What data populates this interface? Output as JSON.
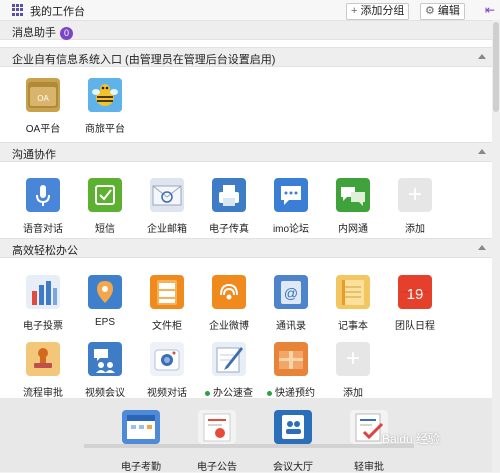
{
  "header": {
    "title": "我的工作台",
    "add_group": "添加分组",
    "edit": "编辑"
  },
  "msg": {
    "label": "消息助手",
    "count": "0"
  },
  "sections": {
    "enterprise": "企业自有信息系统入口 (由管理员在管理后台设置启用)",
    "communication": "沟通协作",
    "office": "高效轻松办公"
  },
  "enterprise_apps": [
    {
      "name": "OA平台",
      "icon": "oa-folder-icon",
      "color": "#c9a24c"
    },
    {
      "name": "商旅平台",
      "icon": "bee-icon",
      "color": "#2a8fd8"
    }
  ],
  "comm_apps": [
    {
      "name": "语音对话",
      "icon": "microphone-icon",
      "color": "#4a86d8"
    },
    {
      "name": "短信",
      "icon": "sms-icon",
      "color": "#5cb130"
    },
    {
      "name": "企业邮箱",
      "icon": "email-icon",
      "color": "#9aa8bd"
    },
    {
      "name": "电子传真",
      "icon": "fax-icon",
      "color": "#3e7cc6"
    },
    {
      "name": "imo论坛",
      "icon": "forum-icon",
      "color": "#3a7fd5"
    },
    {
      "name": "内网通",
      "icon": "intranet-chat-icon",
      "color": "#3fa23a"
    },
    {
      "name": "添加",
      "icon": "add-icon",
      "color": "#e6e6e6"
    }
  ],
  "office_apps": [
    {
      "name": "电子投票",
      "icon": "bar-chart-icon",
      "color": "#e8eef7"
    },
    {
      "name": "EPS",
      "icon": "location-pin-icon",
      "color": "#3e80cc"
    },
    {
      "name": "文件柜",
      "icon": "file-cabinet-icon",
      "color": "#f08a1c"
    },
    {
      "name": "企业微博",
      "icon": "weibo-icon",
      "color": "#f08a1c"
    },
    {
      "name": "通讯录",
      "icon": "address-book-icon",
      "color": "#4d84cc"
    },
    {
      "name": "记事本",
      "icon": "notebook-icon",
      "color": "#f2c661"
    },
    {
      "name": "团队日程",
      "icon": "calendar-19-icon",
      "color": "#e4402c"
    },
    {
      "name": "流程审批",
      "icon": "stamp-icon",
      "color": "#f3c77a"
    },
    {
      "name": "视频会议",
      "icon": "video-meeting-icon",
      "color": "#3e7cc6"
    },
    {
      "name": "视频对话",
      "icon": "camera-icon",
      "color": "#eef2f8"
    },
    {
      "name": "办公速查",
      "icon": "pen-notebook-icon",
      "color": "#e8eef7"
    },
    {
      "name": "快递预约",
      "icon": "package-icon",
      "color": "#e8833a"
    },
    {
      "name": "添加",
      "icon": "add-icon",
      "color": "#e6e6e6"
    }
  ],
  "bottom_apps": [
    {
      "name": "电子考勤",
      "icon": "attendance-calendar-icon",
      "color": "#4d8ad8"
    },
    {
      "name": "电子公告",
      "icon": "notice-icon",
      "color": "#e84b3a"
    },
    {
      "name": "会议大厅",
      "icon": "meeting-hall-icon",
      "color": "#2a6fb8"
    },
    {
      "name": "轻审批",
      "icon": "checklist-icon",
      "color": "#e04040"
    }
  ],
  "watermark": "Baidu 经验"
}
